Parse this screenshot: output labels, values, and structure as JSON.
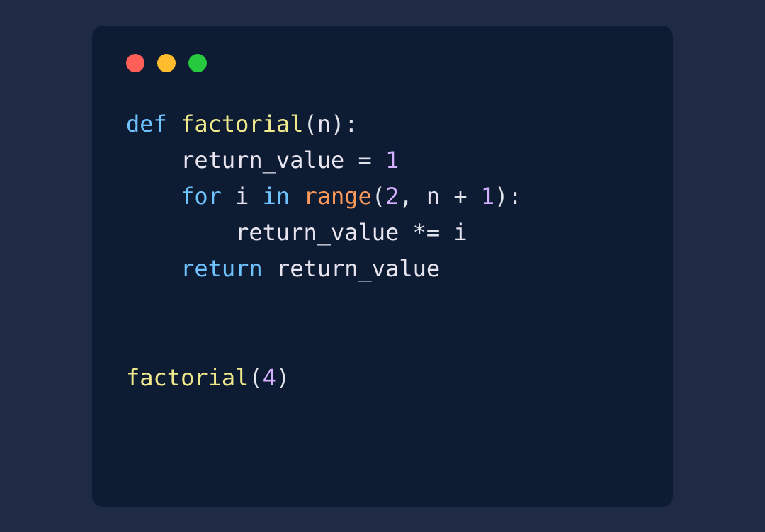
{
  "window": {
    "controls": {
      "close_color": "#ff5f56",
      "minimize_color": "#ffbd2e",
      "maximize_color": "#27c93f"
    }
  },
  "code": {
    "language": "python",
    "tokens": {
      "kw_def": "def",
      "fn_factorial": "factorial",
      "lparen1": "(",
      "param_n": "n",
      "rparen1": ")",
      "colon1": ":",
      "indent1": "    ",
      "var_return_value1": "return_value",
      "op_assign": " = ",
      "num_1": "1",
      "indent2": "    ",
      "kw_for": "for",
      "sp1": " ",
      "var_i": "i",
      "sp2": " ",
      "kw_in": "in",
      "sp3": " ",
      "bi_range": "range",
      "lparen2": "(",
      "num_2": "2",
      "comma1": ", ",
      "var_n2": "n",
      "op_plus": " + ",
      "num_1b": "1",
      "rparen2": ")",
      "colon2": ":",
      "indent3": "        ",
      "var_return_value2": "return_value",
      "op_muleq": " *= ",
      "var_i2": "i",
      "indent4": "    ",
      "kw_return": "return",
      "sp4": " ",
      "var_return_value3": "return_value",
      "blank": "",
      "blank2": "",
      "fn_call_factorial": "factorial",
      "lparen3": "(",
      "num_4": "4",
      "rparen3": ")"
    }
  },
  "colors": {
    "background_outer": "#1f2a44",
    "background_window": "#0d1b33",
    "keyword": "#6fc3ff",
    "function": "#f0e98c",
    "variable": "#e8e5f0",
    "number": "#d4b0ff",
    "builtin": "#ff9b5a",
    "default": "#e0e3ea"
  }
}
